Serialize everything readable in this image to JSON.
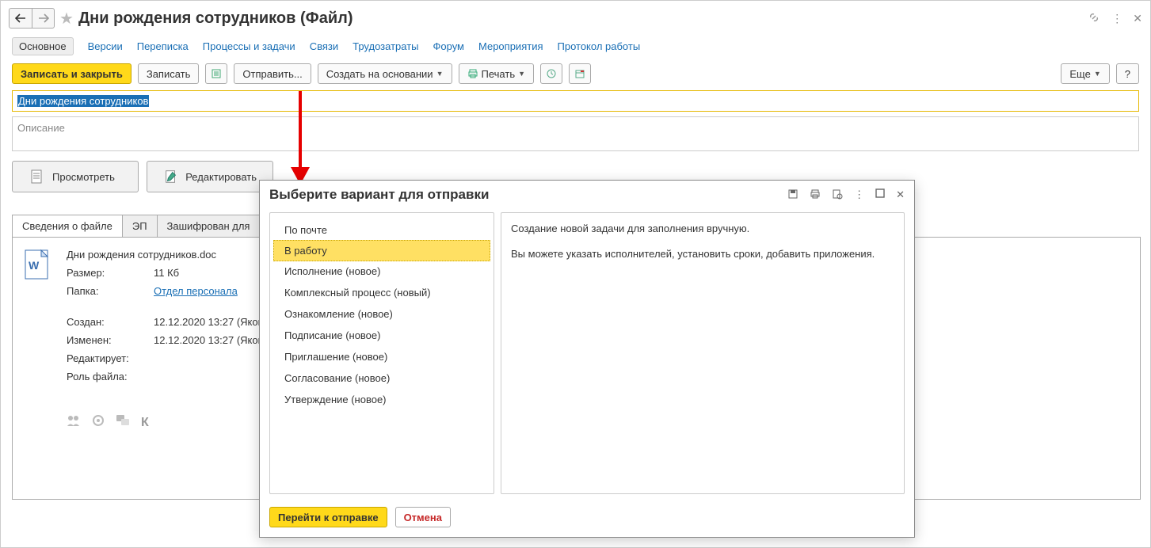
{
  "header": {
    "title": "Дни рождения сотрудников (Файл)"
  },
  "nav": {
    "active": "Основное",
    "tabs": [
      "Основное",
      "Версии",
      "Переписка",
      "Процессы и задачи",
      "Связи",
      "Трудозатраты",
      "Форум",
      "Мероприятия",
      "Протокол работы"
    ]
  },
  "toolbar": {
    "save_close": "Записать и закрыть",
    "save": "Записать",
    "send": "Отправить...",
    "create_based": "Создать на основании",
    "print": "Печать",
    "more": "Еще",
    "help": "?"
  },
  "fields": {
    "title_value": "Дни рождения сотрудников",
    "description_placeholder": "Описание"
  },
  "bigbuttons": {
    "view": "Просмотреть",
    "edit": "Редактировать"
  },
  "filetabs": [
    "Сведения о файле",
    "ЭП",
    "Зашифрован для"
  ],
  "fileinfo": {
    "filename": "Дни рождения сотрудников.doc",
    "size_label": "Размер:",
    "size_value": "11 Кб",
    "folder_label": "Папка:",
    "folder_value": "Отдел персонала",
    "created_label": "Создан:",
    "created_value": "12.12.2020 13:27 (Яков",
    "modified_label": "Изменен:",
    "modified_value": "12.12.2020 13:27 (Яков",
    "editing_label": "Редактирует:",
    "editing_value": "",
    "role_label": "Роль файла:",
    "role_value": "",
    "status_k": "К"
  },
  "dialog": {
    "title": "Выберите вариант для отправки",
    "options": [
      "По почте",
      "В работу",
      "Исполнение (новое)",
      "Комплексный процесс (новый)",
      "Ознакомление (новое)",
      "Подписание (новое)",
      "Приглашение (новое)",
      "Согласование (новое)",
      "Утверждение (новое)"
    ],
    "selected_index": 1,
    "description_line1": "Создание новой задачи для заполнения вручную.",
    "description_line2": "Вы можете указать исполнителей, установить сроки, добавить приложения.",
    "go_button": "Перейти к отправке",
    "cancel_button": "Отмена"
  }
}
